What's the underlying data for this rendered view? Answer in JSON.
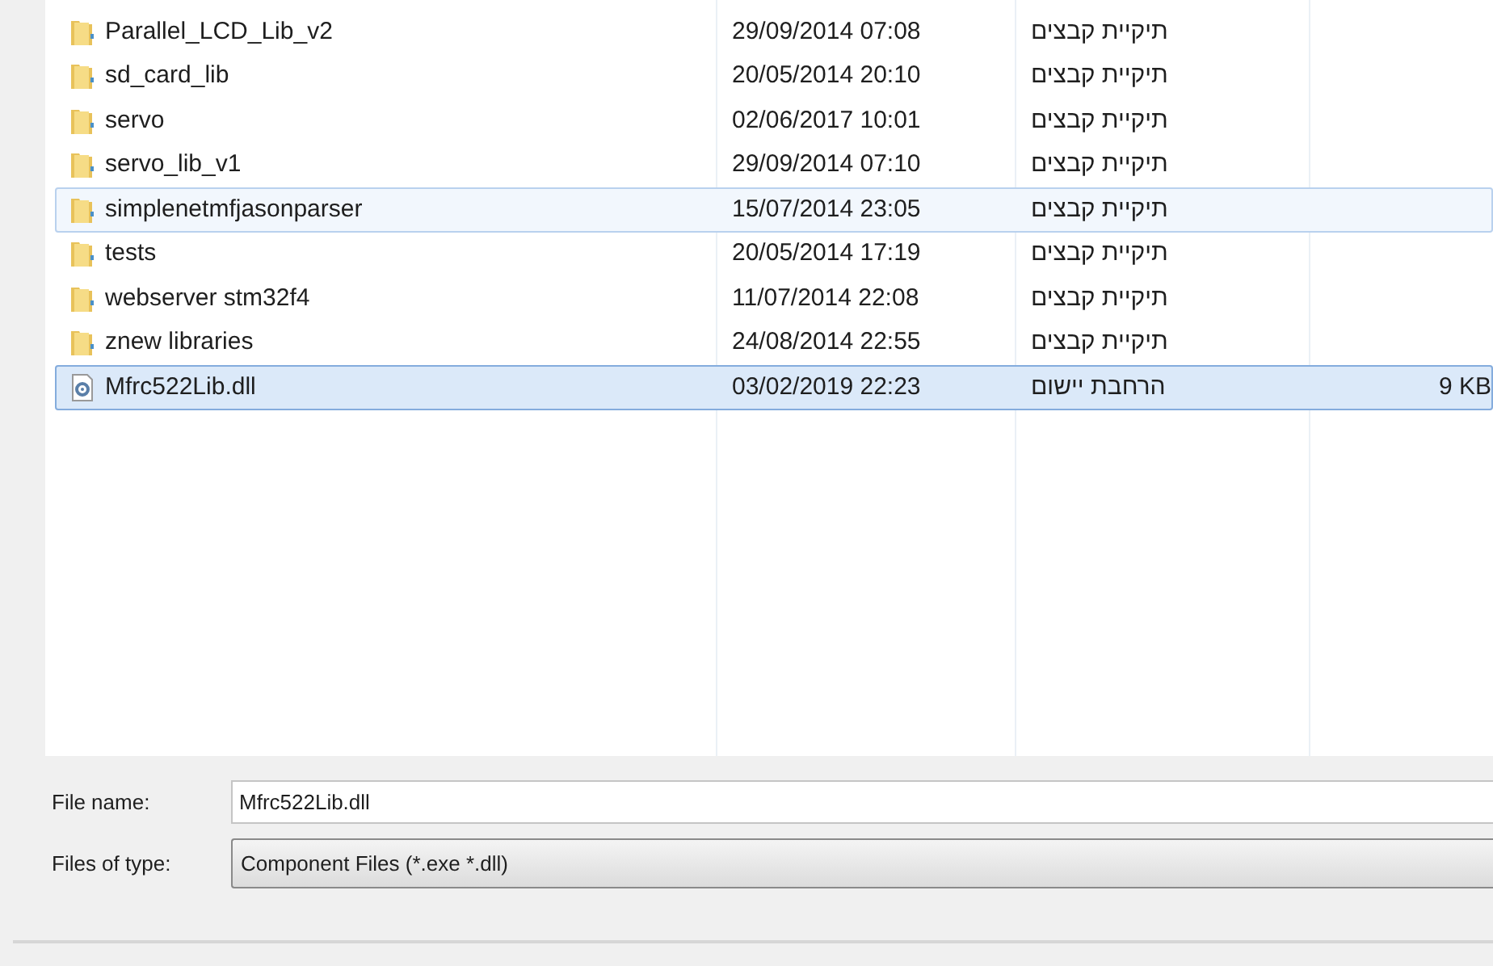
{
  "files": [
    {
      "name": "Parallel_LCD_Lib_v2",
      "kind": "folder",
      "date": "29/09/2014 07:08",
      "type": "תיקיית קבצים",
      "selected": false,
      "hovered": false
    },
    {
      "name": "sd_card_lib",
      "kind": "folder",
      "date": "20/05/2014 20:10",
      "type": "תיקיית קבצים",
      "selected": false,
      "hovered": false
    },
    {
      "name": "servo",
      "kind": "folder",
      "date": "02/06/2017 10:01",
      "type": "תיקיית קבצים",
      "selected": false,
      "hovered": false
    },
    {
      "name": "servo_lib_v1",
      "kind": "folder",
      "date": "29/09/2014 07:10",
      "type": "תיקיית קבצים",
      "selected": false,
      "hovered": false
    },
    {
      "name": "simplenetmfjasonparser",
      "kind": "folder",
      "date": "15/07/2014 23:05",
      "type": "תיקיית קבצים",
      "selected": false,
      "hovered": true
    },
    {
      "name": "tests",
      "kind": "folder",
      "date": "20/05/2014 17:19",
      "type": "תיקיית קבצים",
      "selected": false,
      "hovered": false
    },
    {
      "name": "webserver stm32f4",
      "kind": "folder",
      "date": "11/07/2014 22:08",
      "type": "תיקיית קבצים",
      "selected": false,
      "hovered": false
    },
    {
      "name": "znew libraries",
      "kind": "folder",
      "date": "24/08/2014 22:55",
      "type": "תיקיית קבצים",
      "selected": false,
      "hovered": false
    },
    {
      "name": "Mfrc522Lib.dll",
      "kind": "dll",
      "date": "03/02/2019 22:23",
      "type": "הרחבת יישום",
      "size": "9 KB",
      "selected": true,
      "hovered": false
    }
  ],
  "file_name": {
    "label": "File name:",
    "value": "Mfrc522Lib.dll"
  },
  "file_type": {
    "label": "Files of type:",
    "value": "Component Files (*.exe *.dll)"
  }
}
